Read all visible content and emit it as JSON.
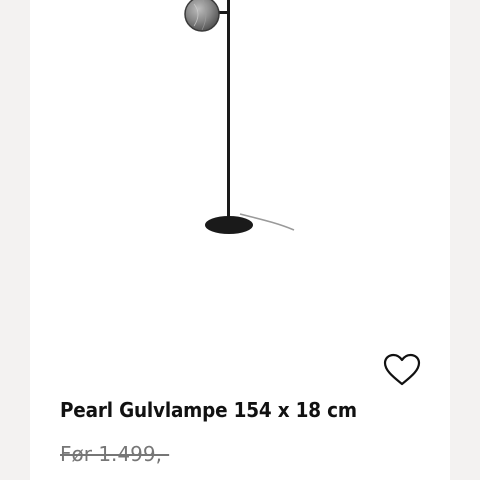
{
  "product": {
    "title": "Pearl Gulvlampe 154 x 18 cm",
    "old_price": "Før 1.499,-",
    "image": "floor-lamp-image"
  },
  "actions": {
    "favorite_icon": "heart-outline-icon"
  },
  "colors": {
    "background": "#f3f2f1",
    "card": "#ffffff",
    "text": "#111111",
    "muted": "#767676",
    "lamp_body": "#1a1a1a"
  }
}
